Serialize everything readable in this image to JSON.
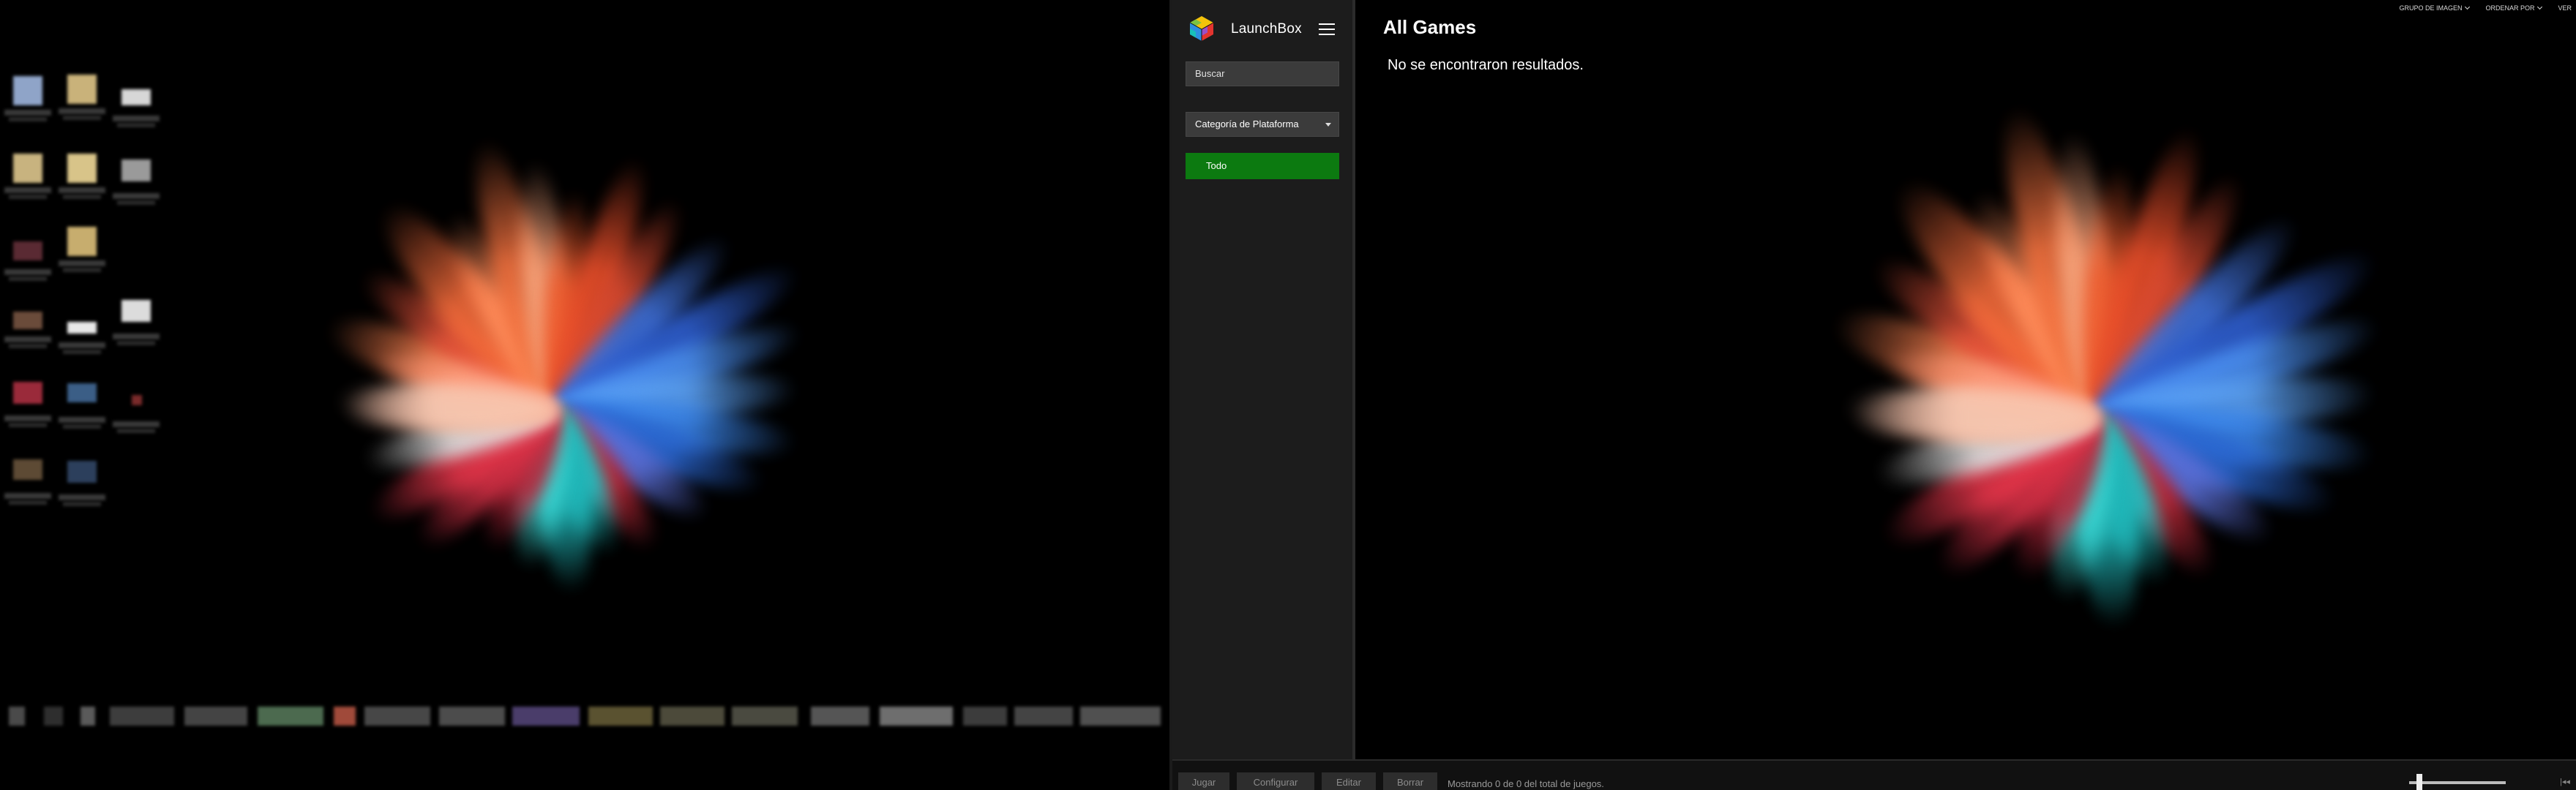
{
  "launchbox": {
    "app_title": "LaunchBox",
    "search": {
      "placeholder": "Buscar"
    },
    "category_dropdown": {
      "selected": "Categoría de Plataforma"
    },
    "platform_filter": {
      "selected": "Todo"
    },
    "main": {
      "heading": "All Games",
      "empty_message": "No se encontraron resultados."
    },
    "top_right": {
      "image_group": "GRUPO DE IMAGEN",
      "sort_by": "ORDENAR POR",
      "view": "VER"
    },
    "bottom_bar": {
      "play": "Jugar",
      "configure": "Configurar",
      "edit": "Editar",
      "delete": "Borrar",
      "status": "Mostrando 0 de 0 del total de juegos.",
      "zoom_end_icon": "|◂◂"
    }
  },
  "icons": {
    "logo": "launchbox-cube-icon",
    "menu": "hamburger-icon",
    "dropdown_caret": "caret-down-icon"
  },
  "colors": {
    "accent_green": "#0c7a10",
    "sidebar_bg": "#1c1c1c",
    "input_bg": "#3b3b3b"
  }
}
